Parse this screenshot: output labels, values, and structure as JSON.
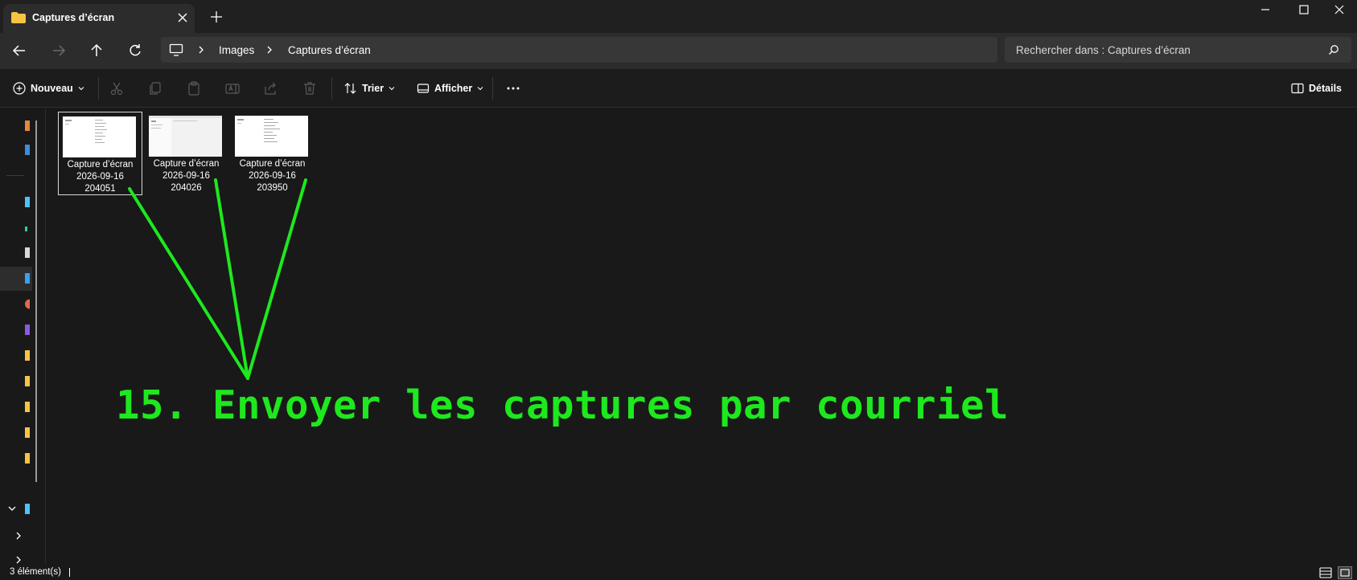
{
  "window": {
    "tab_title": "Captures d’écran"
  },
  "address": {
    "crumbs": [
      "Images",
      "Captures d’écran"
    ]
  },
  "search": {
    "placeholder": "Rechercher dans : Captures d’écran"
  },
  "toolbar": {
    "new_label": "Nouveau",
    "sort_label": "Trier",
    "view_label": "Afficher",
    "details_label": "Détails"
  },
  "files": [
    {
      "line1": "Capture d’écran",
      "line2": "2026-09-16",
      "line3": "204051",
      "selected": true
    },
    {
      "line1": "Capture d’écran",
      "line2": "2026-09-16",
      "line3": "204026",
      "selected": false
    },
    {
      "line1": "Capture d’écran",
      "line2": "2026-09-16",
      "line3": "203950",
      "selected": false
    }
  ],
  "annotation": {
    "text": "15. Envoyer les captures par courriel",
    "color": "#1ee81e"
  },
  "status": {
    "count_text": "3 élément(s)"
  },
  "colors": {
    "accent": "#4cc2ff",
    "folder": "#f5c542"
  }
}
